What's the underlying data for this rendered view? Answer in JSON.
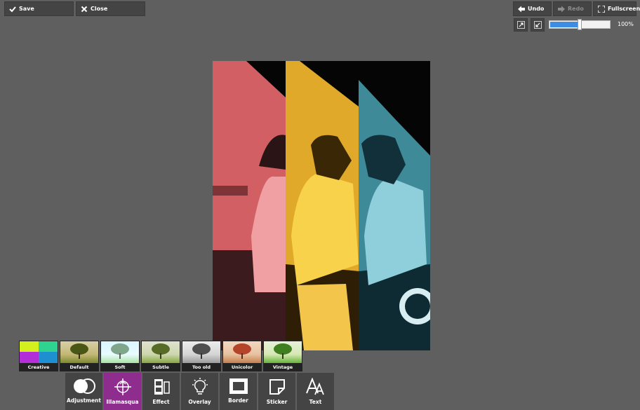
{
  "toolbar": {
    "save": "Save",
    "close": "Close",
    "undo": "Undo",
    "redo": "Redo",
    "fullscreen": "Fullscreen"
  },
  "zoom": {
    "level_percent": 100,
    "label": "100%",
    "slider_fraction": 0.5
  },
  "filters": [
    "Creative",
    "Default",
    "Soft",
    "Subtle",
    "Too old",
    "Unicolor",
    "Vintage"
  ],
  "tools": [
    "Adjustment",
    "Illamasqua",
    "Effect",
    "Overlay",
    "Border",
    "Sticker",
    "Text"
  ],
  "active_tool": "Illamasqua",
  "colors": {
    "panel": "#444444",
    "background": "#5f5f5f",
    "active_tool": "#8e2d8e",
    "slider": "#3d8ee3",
    "band_red": "#d25f63",
    "band_yellow": "#e0a92a",
    "band_teal": "#3f8a99"
  }
}
